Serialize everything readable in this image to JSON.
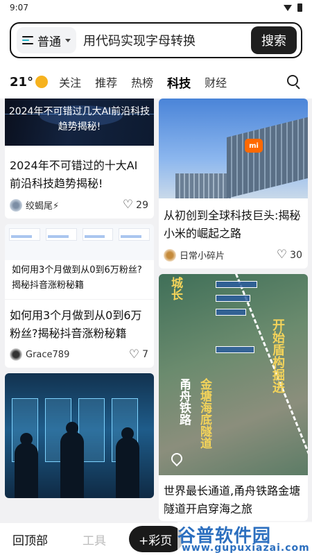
{
  "status": {
    "time": "9:07"
  },
  "search": {
    "mode": "普通",
    "query": "用代码实现字母转换",
    "button": "搜索"
  },
  "tabs": {
    "temperature": "21°",
    "items": [
      "关注",
      "推荐",
      "热榜",
      "科技",
      "财经"
    ],
    "active": "科技"
  },
  "feed": {
    "left": [
      {
        "image_caption": "2024年不可错过几大AI前沿科技趋势揭秘!",
        "title": "2024年不可错过的十大AI前沿科技趋势揭秘!",
        "author": "绞蝎尾⚡",
        "likes": "29"
      },
      {
        "image_caption": "如何用3个月做到从0到6万粉丝?揭秘抖音涨粉秘籍",
        "title": "如何用3个月做到从0到6万粉丝?揭秘抖音涨粉秘籍",
        "author": "Grace789",
        "likes": "7"
      }
    ],
    "right": [
      {
        "image_caption": "mi",
        "title": "从初创到全球科技巨头:揭秘小米的崛起之路",
        "author": "日常小碎片",
        "likes": "30"
      },
      {
        "image_text": [
          "城长",
          "开始盾构掘进",
          "甬舟铁路",
          "金塘海底隧道"
        ],
        "title": "世界最长通道,甬舟铁路金塘隧道开启穿海之旅"
      }
    ]
  },
  "bottom": {
    "back_top": "回顶部",
    "tools": "工具",
    "fab": "+彩页"
  },
  "watermark": {
    "main": "谷普软件园",
    "sub": "www.gupuxiazai.com"
  }
}
